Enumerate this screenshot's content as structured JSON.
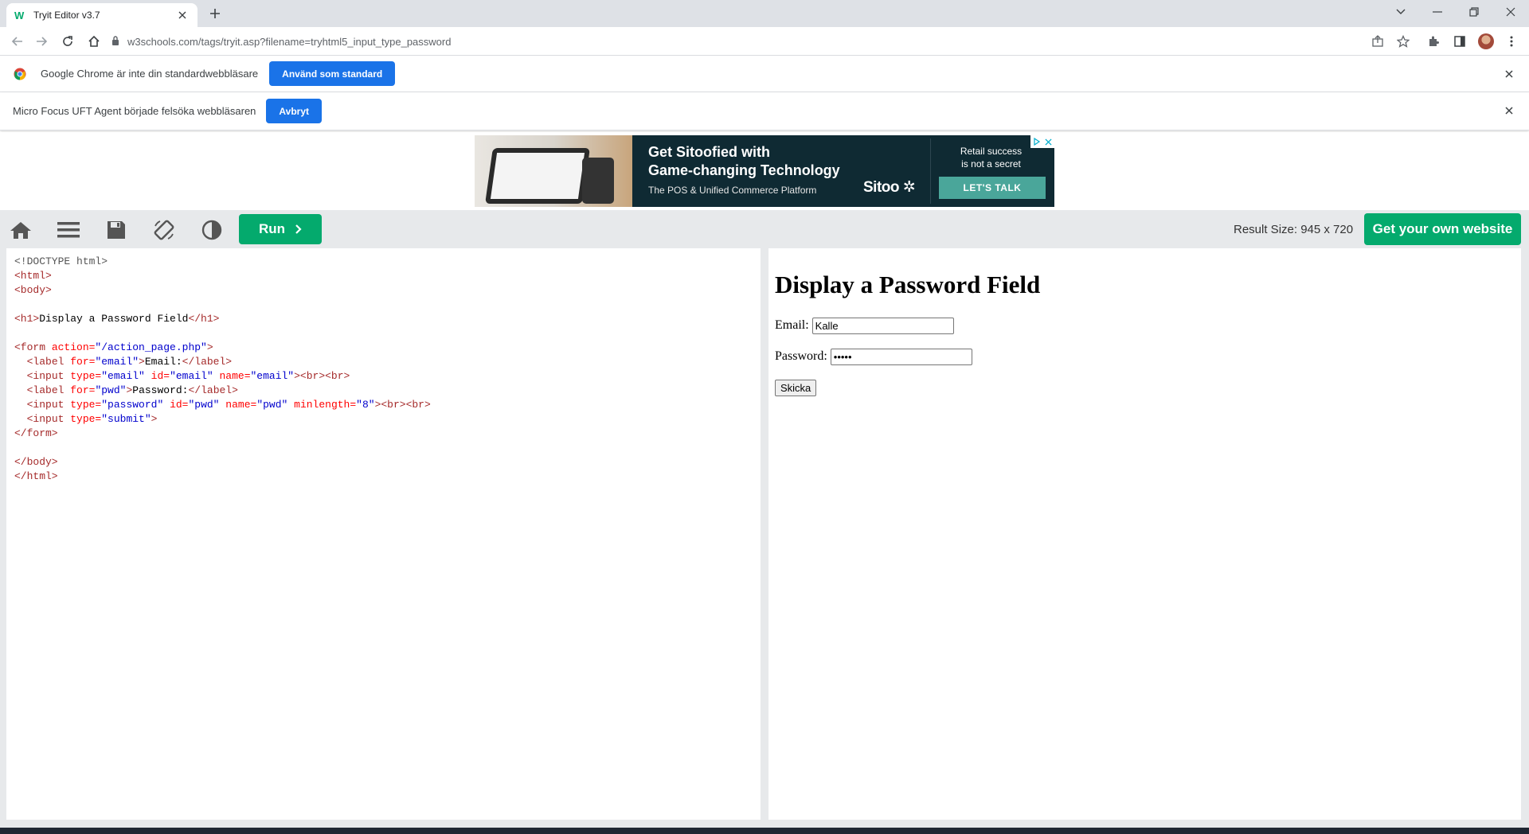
{
  "browser": {
    "tab_title": "Tryit Editor v3.7",
    "url": "w3schools.com/tags/tryit.asp?filename=tryhtml5_input_type_password"
  },
  "infobars": {
    "default_browser": {
      "message": "Google Chrome är inte din standardwebbläsare",
      "button": "Använd som standard"
    },
    "uft_agent": {
      "message": "Micro Focus UFT Agent började felsöka webbläsaren",
      "button": "Avbryt"
    }
  },
  "ad": {
    "headline_1": "Get Sitoofied with",
    "headline_2": "Game-changing Technology",
    "subline": "The POS & Unified Commerce Platform",
    "logo": "Sitoo",
    "right_line_1": "Retail success",
    "right_line_2": "is not a secret",
    "cta": "LET'S TALK"
  },
  "tryit_toolbar": {
    "run_label": "Run",
    "result_size_label": "Result Size: 945 x 720",
    "own_site_label": "Get your own website"
  },
  "result": {
    "heading": "Display a Password Field",
    "email_label": "Email:",
    "email_value": "Kalle",
    "password_label": "Password:",
    "password_value": "•••••",
    "submit_label": "Skicka"
  },
  "colors": {
    "brand_green": "#04aa6d",
    "chrome_blue": "#1a73e8",
    "ad_background": "#0f2a33"
  }
}
